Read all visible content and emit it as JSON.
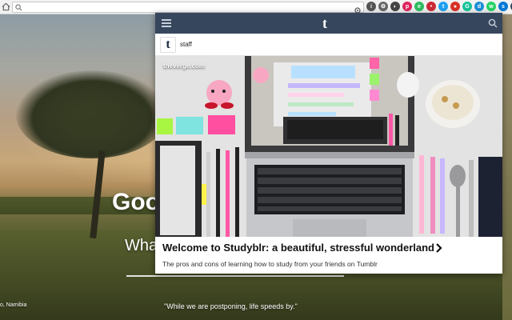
{
  "browser": {
    "omnibox_value": "",
    "extensions": [
      {
        "icon": "info-icon",
        "color": "#555555",
        "glyph": "i"
      },
      {
        "icon": "settings-icon",
        "color": "#666666",
        "glyph": "⚙"
      },
      {
        "icon": "moon-icon",
        "color": "#444444",
        "glyph": "◐"
      },
      {
        "icon": "pocket-icon",
        "color": "#e0245e",
        "glyph": "p"
      },
      {
        "icon": "evernote-icon",
        "color": "#2dbe60",
        "glyph": "e"
      },
      {
        "icon": "lastpass-icon",
        "color": "#cc2a36",
        "glyph": "•"
      },
      {
        "icon": "twitter-icon",
        "color": "#1da1f2",
        "glyph": "t"
      },
      {
        "icon": "record-icon",
        "color": "#d93025",
        "glyph": "●"
      },
      {
        "icon": "grammarly-icon",
        "color": "#15c39a",
        "glyph": "G"
      },
      {
        "icon": "dashlane-icon",
        "color": "#1b8fd6",
        "glyph": "d"
      },
      {
        "icon": "whatsapp-icon",
        "color": "#25d366",
        "glyph": "w"
      },
      {
        "icon": "skype-icon",
        "color": "#0078d7",
        "glyph": "s"
      },
      {
        "icon": "tumblr-extension-icon",
        "color": "#36465d",
        "glyph": "t"
      }
    ]
  },
  "background": {
    "greeting": "Goo",
    "focus_prompt": "What",
    "quote": "\"While we are postponing, life speeds by.\"",
    "location": "o, Namibia"
  },
  "popup": {
    "logo": "t",
    "blog": {
      "avatar_letter": "t",
      "name": "staff"
    },
    "post": {
      "source": "theverge.com",
      "title": "Welcome to Studyblr: a beautiful, stressful wonderland",
      "description": "The pros and cons of learning how to study from your friends on Tumblr"
    }
  },
  "colors": {
    "tumblr_header": "#36465d"
  }
}
